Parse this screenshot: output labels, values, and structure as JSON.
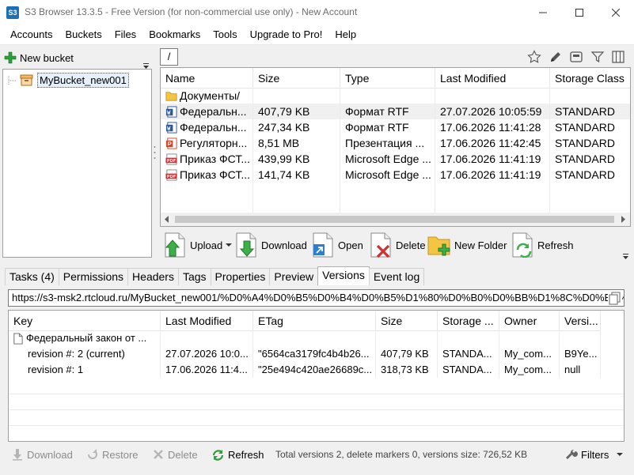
{
  "window": {
    "app_icon_text": "S3",
    "title": "S3 Browser 13.3.5 - Free Version (for non-commercial use only) - New Account"
  },
  "menu": [
    "Accounts",
    "Buckets",
    "Files",
    "Bookmarks",
    "Tools",
    "Upgrade to Pro!",
    "Help"
  ],
  "left_panel": {
    "new_bucket_label": "New bucket",
    "bucket_name": "MyBucket_new001"
  },
  "path": "/",
  "file_list": {
    "columns": [
      "Name",
      "Size",
      "Type",
      "Last Modified",
      "Storage Class"
    ],
    "rows": [
      {
        "icon": "folder-icon",
        "name": "Документы/",
        "size": "",
        "type": "",
        "modified": "",
        "storage": ""
      },
      {
        "icon": "word-doc-icon",
        "name": "Федеральн...",
        "size": "407,79 KB",
        "type": "Формат RTF",
        "modified": "27.07.2026 10:05:59",
        "storage": "STANDARD"
      },
      {
        "icon": "word-doc-icon",
        "name": "Федеральн...",
        "size": "247,34 KB",
        "type": "Формат RTF",
        "modified": "17.06.2026 11:41:28",
        "storage": "STANDARD"
      },
      {
        "icon": "powerpoint-icon",
        "name": "Регуляторн...",
        "size": "8,51 MB",
        "type": "Презентация ...",
        "modified": "17.06.2026 11:42:45",
        "storage": "STANDARD"
      },
      {
        "icon": "pdf-icon",
        "name": "Приказ ФСТ...",
        "size": "439,99 KB",
        "type": "Microsoft Edge ...",
        "modified": "17.06.2026 11:41:19",
        "storage": "STANDARD"
      },
      {
        "icon": "pdf-icon",
        "name": "Приказ ФСТ...",
        "size": "141,74 KB",
        "type": "Microsoft Edge ...",
        "modified": "17.06.2026 11:41:19",
        "storage": "STANDARD"
      }
    ]
  },
  "actions": {
    "upload": "Upload",
    "download": "Download",
    "open": "Open",
    "delete": "Delete",
    "new_folder": "New Folder",
    "refresh": "Refresh"
  },
  "tabs": [
    "Tasks (4)",
    "Permissions",
    "Headers",
    "Tags",
    "Properties",
    "Preview",
    "Versions",
    "Event log"
  ],
  "active_tab": "Versions",
  "versions": {
    "url": "https://s3-msk2.rtcloud.ru/MyBucket_new001/%D0%A4%D0%B5%D0%B4%D0%B5%D1%80%D0%B0%D0%BB%D1%8C%D0%BD%D1%8B%D0%B9",
    "columns": [
      "Key",
      "Last Modified",
      "ETag",
      "Size",
      "Storage ...",
      "Owner",
      "Versi..."
    ],
    "rows": [
      {
        "key": "Федеральный закон от ...",
        "modified": "",
        "etag": "",
        "size": "",
        "storage": "",
        "owner": "",
        "version": ""
      },
      {
        "key": "revision #: 2 (current)",
        "modified": "27.07.2026 10:0...",
        "etag": "\"6564ca3179fc4b4b26...",
        "size": "407,79 KB",
        "storage": "STANDA...",
        "owner": "My_com...",
        "version": "B9Ye..."
      },
      {
        "key": "revision #: 1",
        "modified": "17.06.2026 11:4...",
        "etag": "\"25e494c420ae26689c...",
        "size": "318,73 KB",
        "storage": "STANDA...",
        "owner": "My_com...",
        "version": "null"
      }
    ]
  },
  "bottom_bar": {
    "download": "Download",
    "restore": "Restore",
    "delete": "Delete",
    "refresh": "Refresh",
    "status": "Total versions 2, delete markers 0, versions size: 726,52 KB",
    "filters": "Filters"
  },
  "colors": {
    "accent": "#1f6fb5",
    "selection": "#e5f0fb",
    "pdf_red": "#d32f2f",
    "word_blue": "#2b579a",
    "ppt_orange": "#d24726",
    "folder_yellow": "#f4c542",
    "green": "#2e9d3a"
  }
}
